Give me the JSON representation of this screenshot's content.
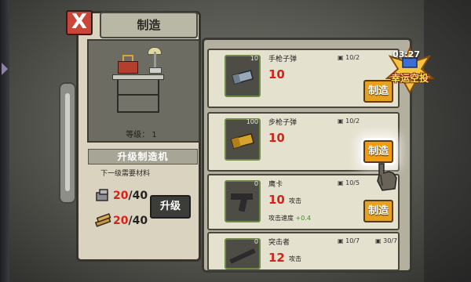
{
  "window": {
    "title": "制造",
    "close_glyph": "X"
  },
  "workbench": {
    "level_label": "等级：",
    "level_value": "1",
    "upgrade_title": "升级制造机",
    "upgrade_requirement": "下一级需要材料",
    "materials": [
      {
        "icon": "metal-parts-icon",
        "have": "20",
        "need": "/40"
      },
      {
        "icon": "wood-planks-icon",
        "have": "20",
        "need": "/40"
      }
    ],
    "upgrade_button": "升级"
  },
  "recipes": [
    {
      "name": "手枪子弹",
      "slot_count": "10",
      "stat": "10",
      "stat_label": "",
      "sub_label": "",
      "sub_value": "",
      "cost": "10/2",
      "cost2": "",
      "button": "制造",
      "icon": "pistol-ammo-icon"
    },
    {
      "name": "步枪子弹",
      "slot_count": "100",
      "stat": "10",
      "stat_label": "",
      "sub_label": "",
      "sub_value": "",
      "cost": "10/2",
      "cost2": "",
      "button": "制造",
      "icon": "rifle-ammo-icon"
    },
    {
      "name": "鹰卡",
      "slot_count": "0",
      "stat": "10",
      "stat_label": "攻击",
      "sub_label": "攻击速度",
      "sub_value": "+0.4",
      "cost": "10/5",
      "cost2": "",
      "button": "制造",
      "icon": "pistol-icon"
    },
    {
      "name": "突击者",
      "slot_count": "0",
      "stat": "12",
      "stat_label": "攻击",
      "sub_label": "",
      "sub_value": "",
      "cost": "10/7",
      "cost2": "30/7",
      "button": "",
      "icon": "rifle-icon"
    }
  ],
  "airdrop": {
    "timer": "03:27",
    "label": "幸运空投"
  },
  "colors": {
    "accent": "#e6a21e",
    "stat_red": "#d3241a",
    "close_red": "#c9473a"
  }
}
